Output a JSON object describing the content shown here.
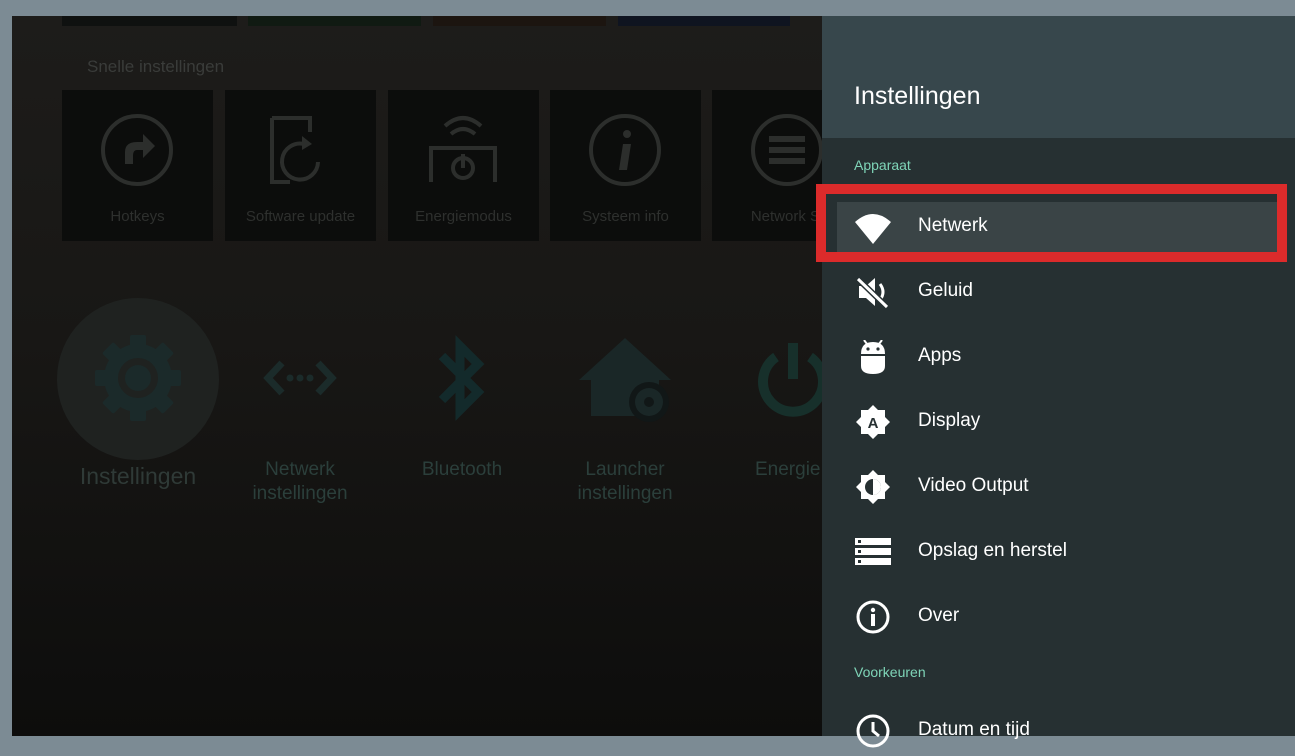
{
  "launcher": {
    "quick_settings_heading": "Snelle instellingen",
    "quick_tiles": [
      {
        "label": "Hotkeys",
        "icon": "shortcut-arrow-icon"
      },
      {
        "label": "Software update",
        "icon": "software-update-icon"
      },
      {
        "label": "Energiemodus",
        "icon": "power-mode-icon"
      },
      {
        "label": "Systeem info",
        "icon": "info-icon"
      },
      {
        "label": "Network St",
        "icon": "network-status-icon"
      }
    ],
    "apps": [
      {
        "label": "Instellingen",
        "icon": "gear-icon"
      },
      {
        "label": "Netwerk instellingen",
        "icon": "network-settings-icon"
      },
      {
        "label": "Bluetooth",
        "icon": "bluetooth-icon"
      },
      {
        "label": "Launcher instellingen",
        "icon": "launcher-settings-icon"
      },
      {
        "label": "Energie",
        "icon": "power-icon"
      }
    ]
  },
  "settings": {
    "title": "Instellingen",
    "section_device": "Apparaat",
    "items": [
      {
        "label": "Netwerk",
        "icon": "wifi-icon"
      },
      {
        "label": "Geluid",
        "icon": "sound-muted-icon"
      },
      {
        "label": "Apps",
        "icon": "android-icon"
      },
      {
        "label": "Display",
        "icon": "display-icon"
      },
      {
        "label": "Video Output",
        "icon": "brightness-icon"
      },
      {
        "label": "Opslag en herstel",
        "icon": "storage-icon"
      },
      {
        "label": "Over",
        "icon": "info-icon"
      }
    ],
    "section_preferences": "Voorkeuren",
    "pref_items": [
      {
        "label": "Datum en tijd",
        "icon": "clock-icon"
      }
    ]
  },
  "colors": {
    "panel_bg": "#263032",
    "header_bg": "#37474c",
    "section_accent": "#7fd5b8",
    "highlight": "#dc2b2b"
  }
}
